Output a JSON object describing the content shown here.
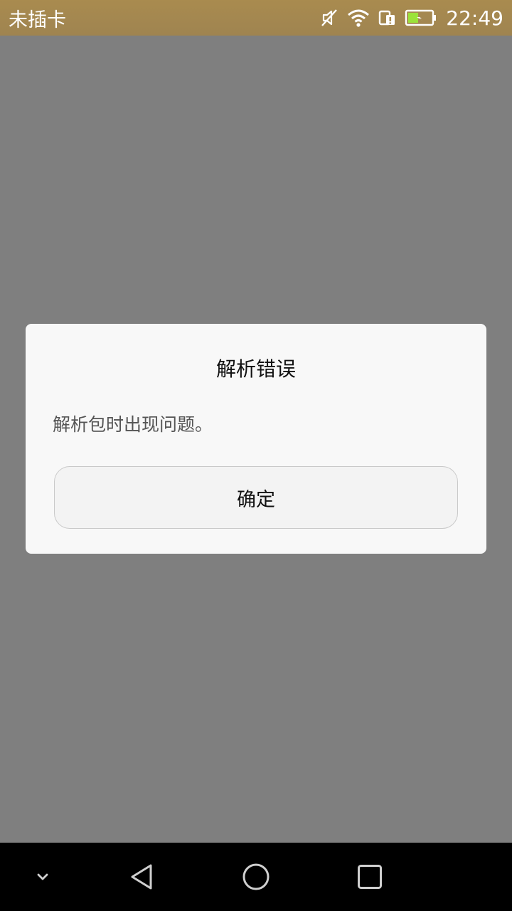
{
  "status_bar": {
    "carrier": "未插卡",
    "time": "22:49",
    "icons": [
      "mute-icon",
      "wifi-icon",
      "sim-icon",
      "battery-charging-icon"
    ]
  },
  "dialog": {
    "title": "解析错误",
    "message": "解析包时出现问题。",
    "ok_label": "确定"
  },
  "nav_bar": {
    "icons": [
      "collapse-down-icon",
      "back-icon",
      "home-icon",
      "recents-icon"
    ]
  },
  "colors": {
    "status_bar": "#a98b4f",
    "scrim": "#7f7f7f",
    "dialog_bg": "#f8f8f8",
    "nav_bar": "#000000"
  }
}
